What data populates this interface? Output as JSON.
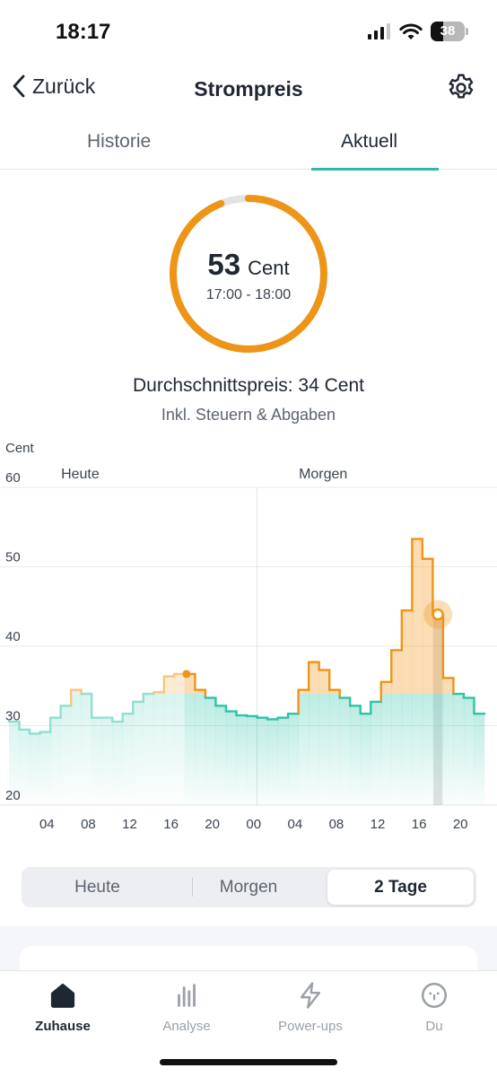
{
  "status_bar": {
    "time": "18:17",
    "battery": "38"
  },
  "nav": {
    "back_label": "Zurück",
    "title": "Strompreis"
  },
  "tabs": [
    {
      "label": "Historie",
      "active": false
    },
    {
      "label": "Aktuell",
      "active": true
    }
  ],
  "current": {
    "price": "53",
    "unit": "Cent",
    "time_range": "17:00 - 18:00",
    "average": "Durchschnittspreis: 34 Cent",
    "tax_note": "Inkl. Steuern & Abgaben",
    "ring_fraction": 0.94
  },
  "chart_data": {
    "type": "line",
    "ylabel": "Cent",
    "ylim": [
      20,
      60
    ],
    "y_ticks": [
      "60",
      "50",
      "40",
      "30",
      "20"
    ],
    "x_ticks": [
      "04",
      "08",
      "12",
      "16",
      "20",
      "00",
      "04",
      "08",
      "12",
      "16",
      "20"
    ],
    "day_labels": [
      "Heute",
      "Morgen"
    ],
    "average": 34,
    "current_hour_index": 17,
    "current_hour_index_tomorrow": 41,
    "series": [
      {
        "values": [
          30.5,
          29.5,
          29,
          29.2,
          31,
          32.5,
          34.5,
          34,
          31,
          31,
          30.5,
          31.5,
          33,
          34,
          34.2,
          36.2,
          36.5,
          36.5,
          34.5,
          33.5,
          32.5,
          31.8,
          31.3,
          31.2,
          31,
          30.8,
          31,
          31.5,
          34.5,
          38,
          37,
          34.5,
          33.5,
          32.5,
          31.5,
          33,
          35.5,
          39.5,
          44.5,
          53.5,
          51,
          44,
          36,
          34,
          33.5,
          31.5
        ]
      }
    ]
  },
  "segmented": {
    "options": [
      "Heute",
      "Morgen",
      "2 Tage"
    ],
    "selected": "2 Tage"
  },
  "bottom_nav": [
    {
      "label": "Zuhause",
      "icon": "house-icon",
      "active": true
    },
    {
      "label": "Analyse",
      "icon": "bar-chart-icon",
      "active": false
    },
    {
      "label": "Power-ups",
      "icon": "lightning-icon",
      "active": false
    },
    {
      "label": "Du",
      "icon": "face-icon",
      "active": false
    }
  ],
  "colors": {
    "orange": "#ee9416",
    "teal": "#2fc3a8",
    "teal_light": "#92dfcf",
    "text": "#1f2733",
    "muted": "#5d6570"
  }
}
